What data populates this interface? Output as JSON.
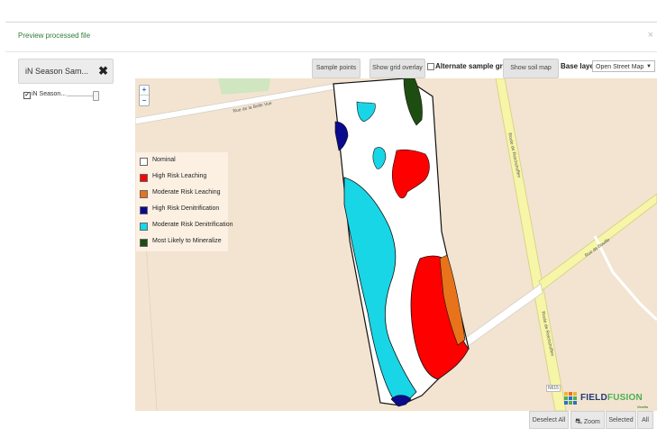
{
  "modal": {
    "title": "Preview processed file",
    "close_icon": "×"
  },
  "layers": {
    "card_title": "iN Season Sam...",
    "remove_icon": "✖",
    "row": {
      "checked": true,
      "check_mark": "✔",
      "name": "iN Season..."
    }
  },
  "toolbar": {
    "sample_points": "Sample points",
    "show_grid_overlay": "Show grid overlay",
    "alternate_sample_grid": "Alternate sample grid",
    "show_soil_map": "Show soil map",
    "base_layer_label": "Base layer:",
    "base_layer_value": "Open Street Map",
    "caret": "▼"
  },
  "map": {
    "zoom_in": "+",
    "zoom_out": "−",
    "streets": {
      "belle_vue": "Rue de la Belle Vue",
      "bouille": "Rue de Bouille",
      "reichshoffen": "Route de Reichshoffen",
      "route_code": "N615"
    },
    "legend": [
      {
        "label": "Nominal",
        "color": "#ffffff"
      },
      {
        "label": "High Risk Leaching",
        "color": "#ff0000"
      },
      {
        "label": "Moderate Risk Leaching",
        "color": "#e8731a"
      },
      {
        "label": "High Risk Denitrification",
        "color": "#0a0a8c"
      },
      {
        "label": "Moderate Risk Denitrification",
        "color": "#19d6e6"
      },
      {
        "label": "Most Likely to Mineralize",
        "color": "#1e4d12"
      }
    ],
    "brand": {
      "name_part1": "FIELD",
      "name_part2": "FUSION",
      "sub": "Verdis"
    },
    "info": "i"
  },
  "bottom": {
    "deselect_all": "Deselect All",
    "zoom": "Zoom",
    "selected": "Selected",
    "all": "All"
  }
}
